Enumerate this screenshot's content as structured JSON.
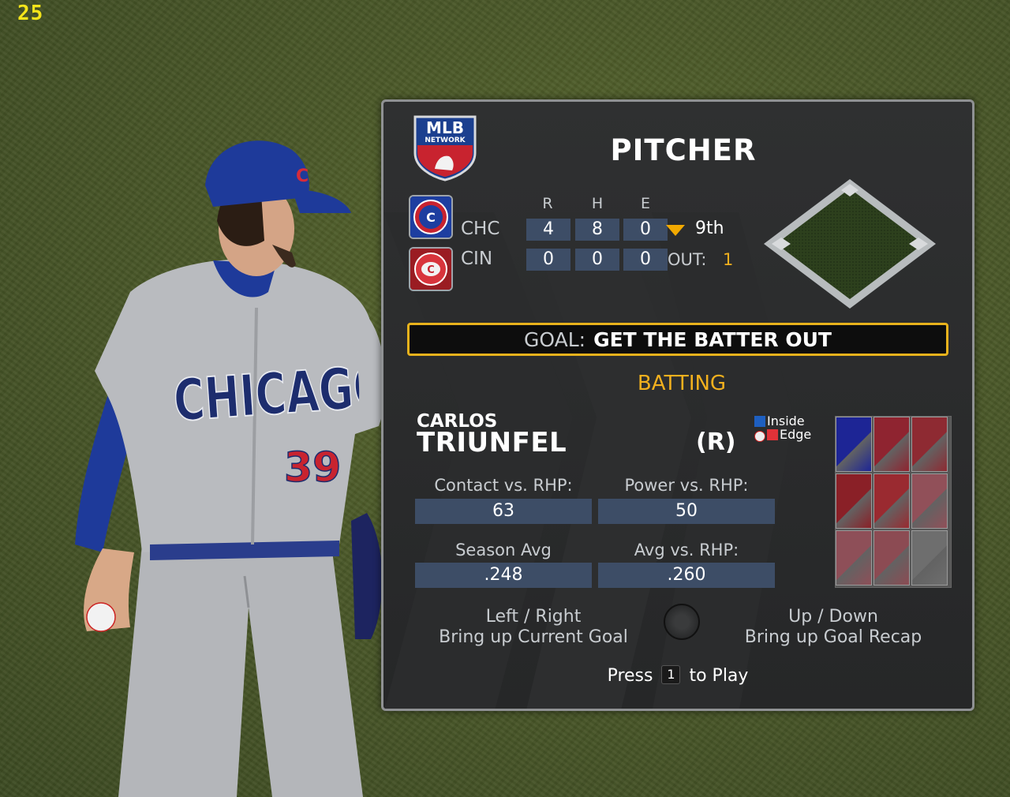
{
  "hud": {
    "fps": "25"
  },
  "player": {
    "jersey_city": "CHICAGO",
    "jersey_number": "39",
    "cap_letter": "C"
  },
  "panel": {
    "network_logo": {
      "line1": "MLB",
      "line2": "NETWORK"
    },
    "title": "PITCHER",
    "scoreboard": {
      "columns": [
        "R",
        "H",
        "E"
      ],
      "teams": [
        {
          "abbr": "CHC",
          "runs": "4",
          "hits": "8",
          "errors": "0",
          "logo_icon": "cubs-logo-icon"
        },
        {
          "abbr": "CIN",
          "runs": "0",
          "hits": "0",
          "errors": "0",
          "logo_icon": "reds-logo-icon"
        }
      ],
      "inning": "9th",
      "inning_half": "bottom",
      "outs_label": "OUT:",
      "outs": "1"
    },
    "goal": {
      "label": "GOAL:",
      "text": "GET THE BATTER OUT"
    },
    "batting_header": "BATTING",
    "batter": {
      "first_name": "CARLOS",
      "last_name": "TRIUNFEL",
      "hand": "(R)",
      "stats": [
        {
          "label": "Contact vs. RHP:",
          "value": "63"
        },
        {
          "label": "Power vs. RHP:",
          "value": "50"
        },
        {
          "label": "Season Avg",
          "value": ".248"
        },
        {
          "label": "Avg vs. RHP:",
          "value": ".260"
        }
      ]
    },
    "inside_edge": {
      "line1": "Inside",
      "line2": "Edge"
    },
    "hot_cold_zone": {
      "colors": [
        "#1d2595",
        "#8f2430",
        "#8e2a32",
        "#8a2027",
        "#9a2a30",
        "#915059",
        "#8e4f58",
        "#8c4b53",
        "#6e6e6e"
      ]
    },
    "hints": {
      "left": {
        "keys": "Left / Right",
        "action": "Bring up Current Goal"
      },
      "right": {
        "keys": "Up / Down",
        "action": "Bring up Goal Recap"
      }
    },
    "press": {
      "before": "Press",
      "key": "1",
      "after": "to Play"
    }
  }
}
